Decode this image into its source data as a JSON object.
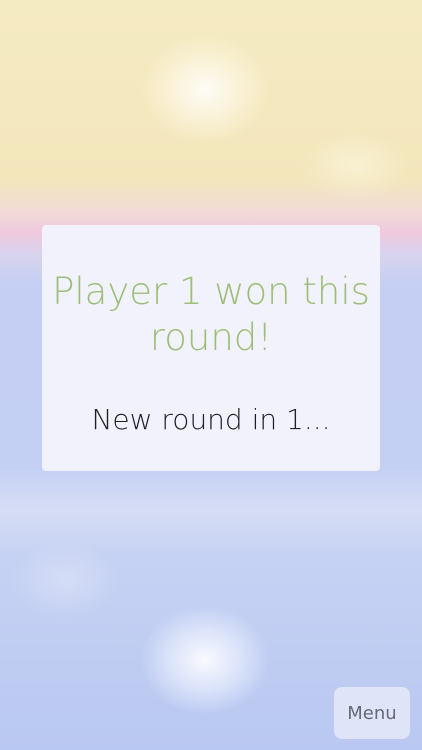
{
  "dialog": {
    "title": "Player 1 won this round!",
    "subtitle": "New round in 1..."
  },
  "menu": {
    "label": "Menu"
  },
  "colors": {
    "win_text": "#9ebd79",
    "dialog_bg": "#f1f2fb",
    "top_zone": "#f5ebc3",
    "bottom_zone": "#c3cff3"
  }
}
